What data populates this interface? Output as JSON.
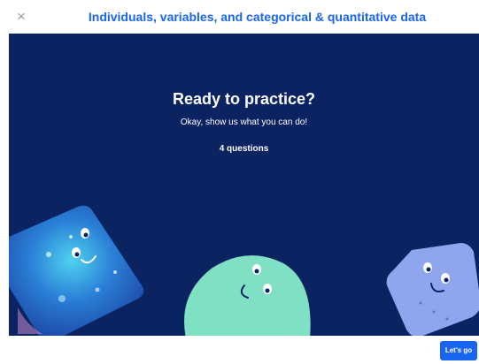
{
  "header": {
    "close_icon": "×",
    "title": "Individuals, variables, and categorical & quantitative data"
  },
  "hero": {
    "title": "Ready to practice?",
    "subtitle": "Okay, show us what you can do!",
    "question_count": "4 questions",
    "background_color": "#0b2361"
  },
  "footer": {
    "lets_go_label": "Let's go"
  },
  "colors": {
    "accent": "#1865f2"
  }
}
